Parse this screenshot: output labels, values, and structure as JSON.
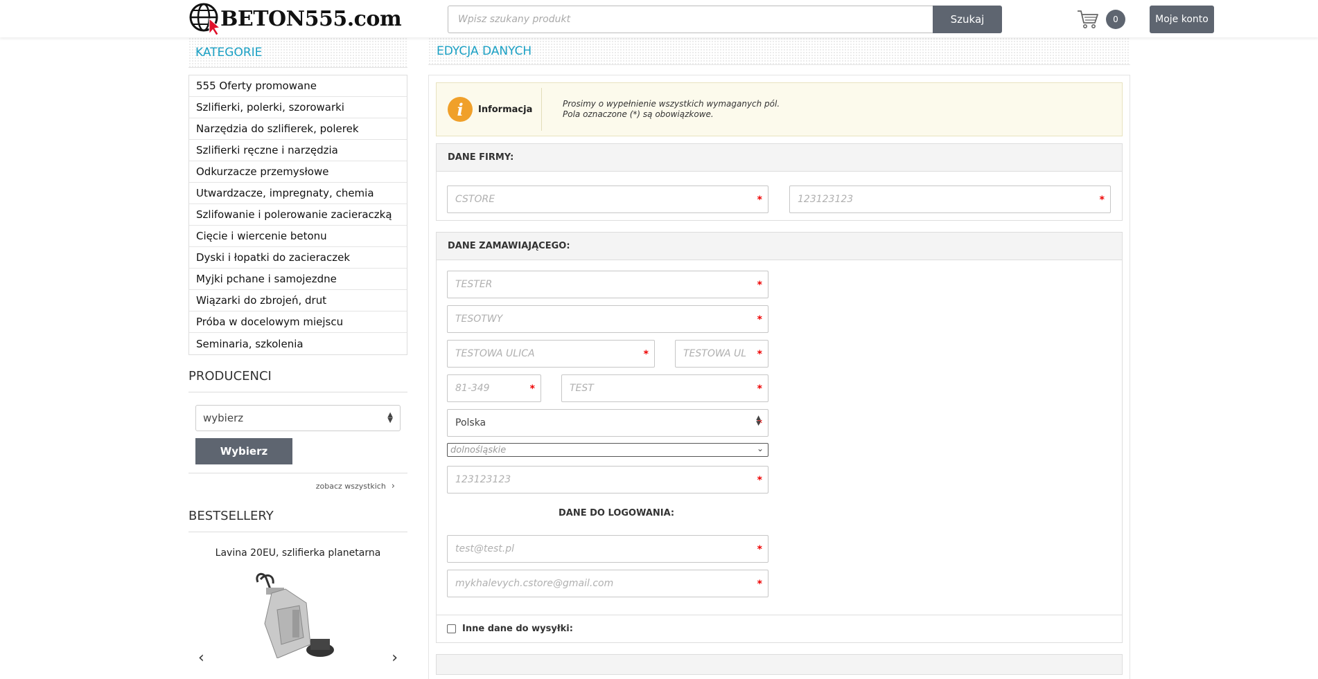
{
  "header": {
    "logo_text": "BETON555.com",
    "search_placeholder": "Wpisz szukany produkt",
    "search_button": "Szukaj",
    "cart_count": "0",
    "account_button": "Moje konto"
  },
  "sidebar": {
    "categories_title": "KATEGORIE",
    "categories": [
      "555 Oferty promowane",
      "Szlifierki, polerki, szorowarki",
      "Narzędzia do szlifierek, polerek",
      "Szlifierki ręczne i narzędzia",
      "Odkurzacze przemysłowe",
      "Utwardzacze, impregnaty, chemia",
      "Szlifowanie i polerowanie zacieraczką",
      "Cięcie i wiercenie betonu",
      "Dyski i łopatki do zacieraczek",
      "Myjki pchane i samojezdne",
      "Wiązarki do zbrojeń, drut",
      "Próba w docelowym miejscu",
      "Seminaria, szkolenia"
    ],
    "producers_title": "PRODUCENCI",
    "producers_select": "wybierz",
    "producers_button": "Wybierz",
    "see_all": "zobacz wszystkich",
    "bestsellers_title": "BESTSELLERY",
    "bestseller_name": "Lavina 20EU, szlifierka planetarna"
  },
  "main": {
    "title": "EDYCJA DANYCH",
    "info_label": "Informacja",
    "info_line1": "Prosimy o wypełnienie wszystkich wymaganych pól.",
    "info_line2": "Pola oznaczone (*) są obowiązkowe.",
    "company_head": "DANE FIRMY:",
    "company_name": "CSTORE",
    "company_nip": "123123123",
    "orderer_head": "DANE ZAMAWIAJĄCEGO:",
    "first_name": "TESTER",
    "last_name": "TESOTWY",
    "street": "TESTOWA ULICA",
    "street_no": "TESTOWA UL",
    "postcode": "81-349",
    "city": "TEST",
    "country": "Polska",
    "region": "dolnośląskie",
    "phone": "123123123",
    "login_head": "DANE DO LOGOWANIA:",
    "email": "test@test.pl",
    "email2": "mykhalevych.cstore@gmail.com",
    "other_shipping": "Inne dane do wysyłki:",
    "required_mark": "*"
  },
  "colors": {
    "accent": "#1aa0c4",
    "button": "#5e6570",
    "info_bg": "#fcfaec",
    "info_icon": "#f0a02a",
    "required": "#e00000"
  }
}
